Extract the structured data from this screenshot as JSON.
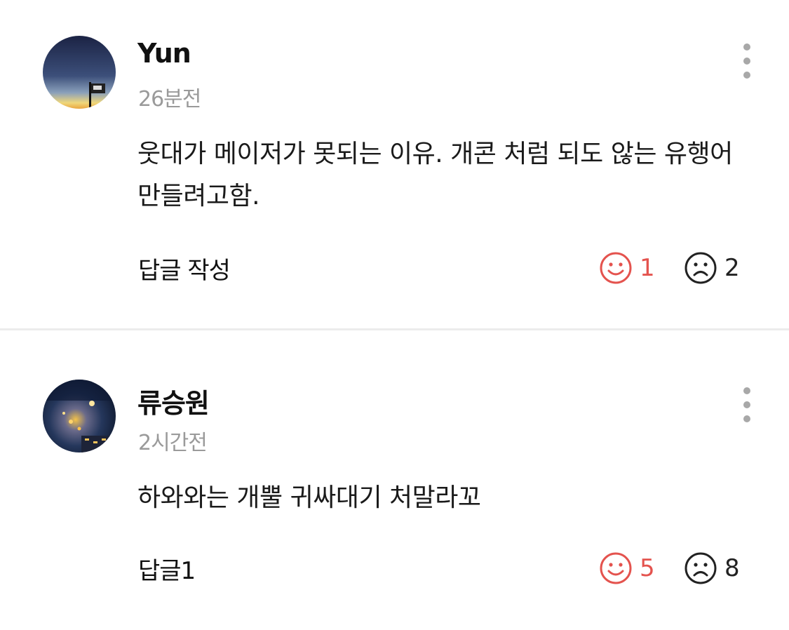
{
  "comments": [
    {
      "author": "Yun",
      "time": "26분전",
      "text": "웃대가 메이저가 못되는 이유. 개콘 처럼 되도 않는 유행어 만들려고함.",
      "reply_label": "답글 작성",
      "likes": "1",
      "dislikes": "2"
    },
    {
      "author": "류승원",
      "time": "2시간전",
      "text": "하와와는 개뿔 귀싸대기 처말라꼬",
      "reply_label": "답글1",
      "likes": "5",
      "dislikes": "8"
    }
  ],
  "icons": {
    "like": "smile-icon",
    "dislike": "frown-icon",
    "more": "more-vertical-icon"
  },
  "colors": {
    "like_accent": "#e4534e",
    "time_gray": "#9a9a9a",
    "divider": "#ececec"
  }
}
